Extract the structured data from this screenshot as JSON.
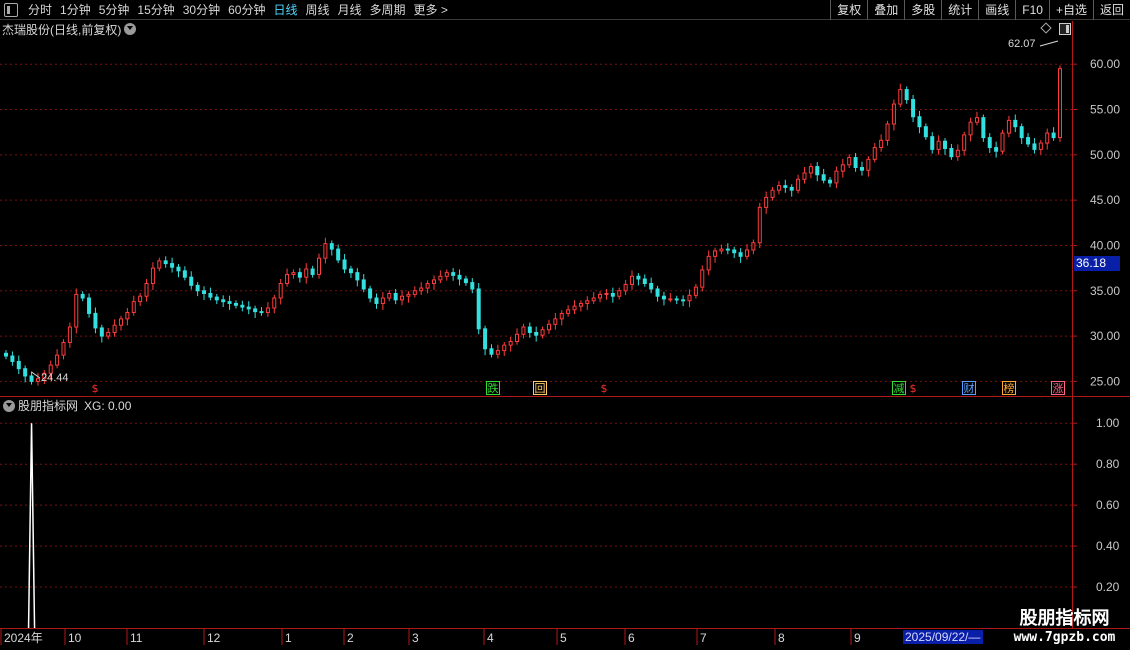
{
  "toolbar": {
    "periods": [
      "分时",
      "1分钟",
      "5分钟",
      "15分钟",
      "30分钟",
      "60分钟",
      "日线",
      "周线",
      "月线",
      "多周期",
      "更多 >"
    ],
    "active_period": "日线",
    "right_buttons": [
      "复权",
      "叠加",
      "多股",
      "统计",
      "画线",
      "F10",
      "+自选",
      "返回"
    ]
  },
  "chart_title": "杰瑞股份(日线,前复权)",
  "indicator": {
    "name": "股朋指标网",
    "xg_label": "XG: 0.00"
  },
  "price_axis": {
    "ticks": [
      "60.00",
      "55.00",
      "50.00",
      "45.00",
      "40.00",
      "35.00",
      "30.00",
      "25.00"
    ]
  },
  "indicator_axis": {
    "ticks": [
      "1.00",
      "0.80",
      "0.60",
      "0.40",
      "0.20"
    ]
  },
  "current_price": "36.18",
  "annotations": {
    "high": "62.07",
    "low": "24.44"
  },
  "date_axis": [
    "2024年",
    "10",
    "11",
    "12",
    "1",
    "2",
    "3",
    "4",
    "5",
    "6",
    "7",
    "8",
    "9"
  ],
  "cursor_date": "2025/09/22/—",
  "signals": [
    {
      "text": "$",
      "color": "#ff3030",
      "kind": "plain"
    },
    {
      "text": "跌",
      "color": "#33dd33",
      "kind": "box"
    },
    {
      "text": "回",
      "color": "#ffcc66",
      "kind": "box"
    },
    {
      "text": "$",
      "color": "#ff3030",
      "kind": "plain"
    },
    {
      "text": "减",
      "color": "#33dd33",
      "kind": "box"
    },
    {
      "text": "$",
      "color": "#ff3030",
      "kind": "plain"
    },
    {
      "text": "财",
      "color": "#5aa0ff",
      "kind": "box"
    },
    {
      "text": "榜",
      "color": "#ffaa33",
      "kind": "box"
    },
    {
      "text": "涨",
      "color": "#ff6688",
      "kind": "box"
    }
  ],
  "watermark": {
    "title": "股朋指标网",
    "url": "www.7gpzb.com"
  },
  "colors": {
    "up": "#ff3c3c",
    "down": "#33e0e0",
    "grid": "#7a1010",
    "axis": "#b01818",
    "ma": "#ffffff"
  },
  "chart_data": {
    "type": "candlestick",
    "ylim": [
      23.5,
      63
    ],
    "indicator_ylim": [
      0,
      1.05
    ],
    "closes": [
      27.8,
      27.2,
      26.4,
      25.6,
      25.0,
      25.3,
      25.9,
      26.8,
      27.9,
      29.3,
      31.0,
      34.6,
      34.2,
      32.5,
      30.9,
      30.0,
      30.4,
      31.2,
      31.9,
      32.6,
      33.8,
      34.4,
      35.8,
      37.5,
      38.3,
      38.0,
      37.6,
      37.2,
      36.5,
      35.6,
      35.0,
      34.7,
      34.3,
      34.0,
      33.8,
      33.6,
      33.4,
      33.2,
      33.0,
      32.7,
      32.6,
      33.1,
      34.2,
      35.8,
      36.8,
      37.0,
      36.5,
      37.4,
      36.8,
      38.6,
      40.2,
      39.6,
      38.4,
      37.4,
      37.0,
      36.2,
      35.2,
      34.2,
      33.6,
      34.2,
      34.7,
      34.0,
      34.4,
      34.6,
      35.0,
      35.3,
      35.8,
      36.2,
      36.6,
      37.0,
      36.7,
      36.3,
      35.9,
      35.2,
      30.8,
      28.6,
      28.0,
      28.4,
      29.0,
      29.4,
      30.2,
      31.0,
      30.4,
      30.1,
      30.7,
      31.3,
      31.9,
      32.5,
      32.9,
      33.3,
      33.6,
      33.9,
      34.2,
      34.6,
      34.7,
      34.4,
      35.0,
      35.7,
      36.6,
      36.3,
      35.8,
      35.2,
      34.4,
      34.1,
      34.1,
      34.0,
      33.9,
      34.5,
      35.4,
      37.3,
      38.8,
      39.4,
      39.6,
      39.5,
      39.2,
      38.8,
      39.5,
      40.3,
      44.2,
      45.3,
      46.1,
      46.6,
      46.4,
      46.1,
      47.3,
      48.0,
      48.7,
      47.8,
      47.2,
      46.9,
      48.2,
      48.9,
      49.7,
      48.6,
      48.3,
      49.5,
      50.8,
      51.6,
      53.4,
      55.6,
      57.2,
      56.1,
      54.2,
      53.1,
      52.0,
      50.6,
      51.5,
      50.7,
      49.8,
      50.5,
      52.2,
      53.6,
      54.1,
      51.9,
      50.8,
      50.4,
      52.4,
      53.8,
      53.1,
      51.9,
      51.2,
      50.6,
      51.3,
      52.4,
      51.9,
      59.5
    ]
  }
}
